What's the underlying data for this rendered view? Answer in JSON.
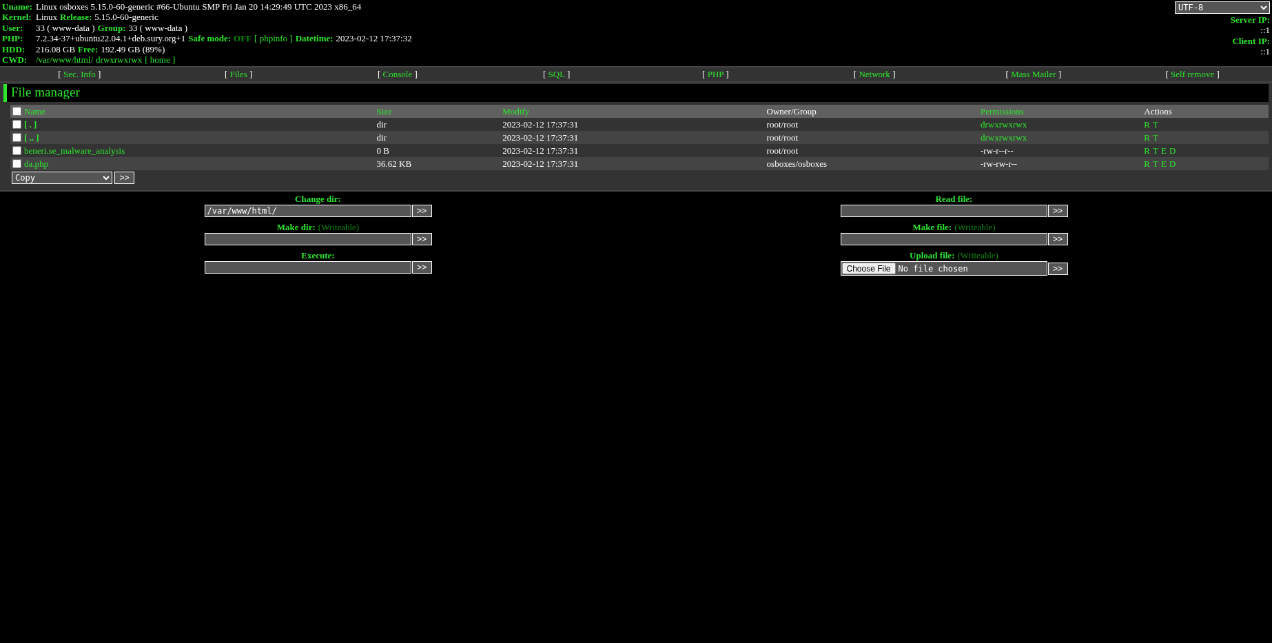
{
  "info": [
    {
      "label": "Uname:",
      "parts": [
        {
          "kind": "value",
          "text": "Linux osboxes 5.15.0-60-generic #66-Ubuntu SMP Fri Jan 20 14:29:49 UTC 2023 x86_64"
        }
      ]
    },
    {
      "label": "Kernel:",
      "parts": [
        {
          "kind": "value",
          "text": "Linux"
        },
        {
          "kind": "label",
          "text": "Release:"
        },
        {
          "kind": "value",
          "text": "5.15.0-60-generic"
        }
      ]
    },
    {
      "label": "User:",
      "parts": [
        {
          "kind": "value",
          "text": "33 ( www-data )"
        },
        {
          "kind": "label",
          "text": "Group:"
        },
        {
          "kind": "value",
          "text": "33 ( www-data )"
        }
      ]
    },
    {
      "label": "PHP:",
      "parts": [
        {
          "kind": "value",
          "text": "7.2.34-37+ubuntu22.04.1+deb.sury.org+1"
        },
        {
          "kind": "label",
          "text": "Safe mode:"
        },
        {
          "kind": "off",
          "text": "OFF"
        },
        {
          "kind": "link",
          "text": "[ phpinfo ]"
        },
        {
          "kind": "label",
          "text": "Datetime:"
        },
        {
          "kind": "value",
          "text": "2023-02-12 17:37:32"
        }
      ]
    },
    {
      "label": "HDD:",
      "parts": [
        {
          "kind": "value",
          "text": "216.08 GB"
        },
        {
          "kind": "label",
          "text": "Free:"
        },
        {
          "kind": "value",
          "text": "192.49 GB (89%)"
        }
      ]
    },
    {
      "label": "CWD:",
      "parts": [
        {
          "kind": "link",
          "text": "/var/www/html/"
        },
        {
          "kind": "link",
          "text": "drwxrwxrwx"
        },
        {
          "kind": "link",
          "text": "[ home ]"
        }
      ]
    }
  ],
  "charset": {
    "value": "UTF-8"
  },
  "server_ip": {
    "label": "Server IP:",
    "value": "::1"
  },
  "client_ip": {
    "label": "Client IP:",
    "value": "::1"
  },
  "menu": [
    {
      "open": "[",
      "label": "Sec. Info",
      "close": "]"
    },
    {
      "open": "[",
      "label": "Files",
      "close": "]"
    },
    {
      "open": "[",
      "label": "Console",
      "close": "]"
    },
    {
      "open": "[",
      "label": "SQL",
      "close": "]"
    },
    {
      "open": "[",
      "label": "PHP",
      "close": "]"
    },
    {
      "open": "[",
      "label": "Network",
      "close": "]"
    },
    {
      "open": "[",
      "label": "Mass Mailer",
      "close": "]"
    },
    {
      "open": "[",
      "label": "Self remove",
      "close": "]"
    }
  ],
  "file_manager": {
    "title": "File manager",
    "columns": [
      {
        "label": "Name",
        "kind": "link"
      },
      {
        "label": "Size",
        "kind": "link"
      },
      {
        "label": "Modify",
        "kind": "link"
      },
      {
        "label": "Owner/Group",
        "kind": "plain"
      },
      {
        "label": "Permissions",
        "kind": "link"
      },
      {
        "label": "Actions",
        "kind": "plain"
      }
    ],
    "select_all": {
      "checked": false
    },
    "rows": [
      {
        "kind": "dir",
        "checked": false,
        "name": "[ . ]",
        "size": "dir",
        "modify": "2023-02-12 17:37:31",
        "owner": "root/root",
        "permissions": "drwxrwxrwx",
        "writable": true,
        "actions": [
          "R",
          "T"
        ]
      },
      {
        "kind": "dir",
        "checked": false,
        "name": "[ .. ]",
        "size": "dir",
        "modify": "2023-02-12 17:37:31",
        "owner": "root/root",
        "permissions": "drwxrwxrwx",
        "writable": true,
        "actions": [
          "R",
          "T"
        ]
      },
      {
        "kind": "file",
        "checked": false,
        "name": "beneri.se_malware_analysis",
        "size": "0 B",
        "modify": "2023-02-12 17:37:31",
        "owner": "root/root",
        "permissions": "-rw-r--r--",
        "writable": false,
        "actions": [
          "R",
          "T",
          "E",
          "D"
        ]
      },
      {
        "kind": "file",
        "checked": false,
        "name": "da.php",
        "size": "36.62 KB",
        "modify": "2023-02-12 17:37:31",
        "owner": "osboxes/osboxes",
        "permissions": "-rw-rw-r--",
        "writable": false,
        "actions": [
          "R",
          "T",
          "E",
          "D"
        ]
      }
    ],
    "action_select": "Copy",
    "submit": ">>"
  },
  "forms": [
    [
      {
        "kind": "text",
        "label": "Change dir:",
        "text": "/var/www/html/",
        "submit": ">>"
      },
      {
        "kind": "text",
        "label": "Make dir:",
        "note": "(Writeable)",
        "submit": ">>"
      },
      {
        "kind": "text",
        "label": "Execute:",
        "submit": ">>"
      }
    ],
    [
      {
        "kind": "text",
        "label": "Read file:",
        "submit": ">>"
      },
      {
        "kind": "text",
        "label": "Make file:",
        "note": "(Writeable)",
        "submit": ">>"
      },
      {
        "kind": "file",
        "label": "Upload file:",
        "note": "(Writeable)",
        "button": "Choose File",
        "status": "No file chosen",
        "submit": ">>"
      }
    ]
  ]
}
